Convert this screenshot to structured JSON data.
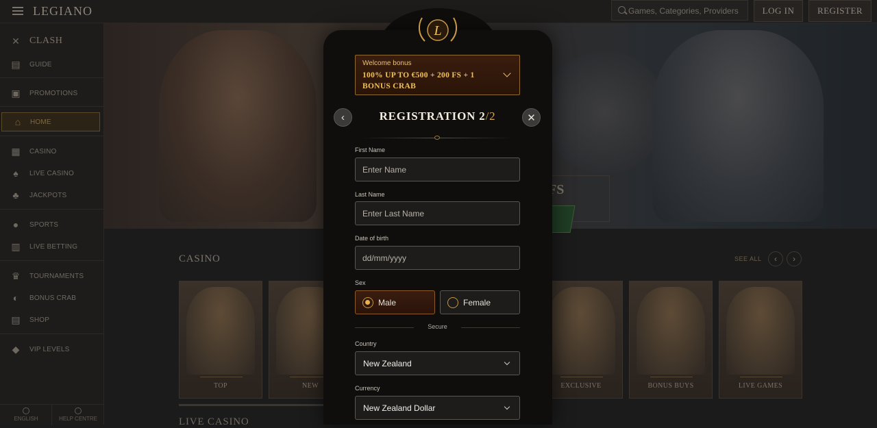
{
  "header": {
    "logo": "LEGIANO",
    "search_placeholder": "Games, Categories, Providers",
    "login_label": "LOG IN",
    "register_label": "REGISTER"
  },
  "sidebar": {
    "items": [
      {
        "label": "CLASH",
        "icon": "crossed-swords-icon"
      },
      {
        "label": "GUIDE",
        "icon": "scroll-icon"
      },
      {
        "label": "PROMOTIONS",
        "icon": "promotions-icon"
      },
      {
        "label": "HOME",
        "icon": "home-icon"
      },
      {
        "label": "CASINO",
        "icon": "slot-machine-icon"
      },
      {
        "label": "LIVE CASINO",
        "icon": "cards-icon"
      },
      {
        "label": "JACKPOTS",
        "icon": "clover-icon"
      },
      {
        "label": "SPORTS",
        "icon": "ball-icon"
      },
      {
        "label": "LIVE BETTING",
        "icon": "stadium-icon"
      },
      {
        "label": "TOURNAMENTS",
        "icon": "trophy-icon"
      },
      {
        "label": "BONUS CRAB",
        "icon": "crab-icon"
      },
      {
        "label": "SHOP",
        "icon": "shop-icon"
      },
      {
        "label": "VIP LEVELS",
        "icon": "diamond-icon"
      }
    ],
    "footer": {
      "language": "ENGLISH",
      "help": "HELP CENTRE"
    }
  },
  "hero": {
    "fs_text": "0 FS"
  },
  "casino_section": {
    "title": "CASINO",
    "see_all": "SEE ALL",
    "cards": [
      "TOP",
      "NEW",
      "",
      "",
      "EXCLUSIVE",
      "BONUS BUYS",
      "LIVE GAMES"
    ]
  },
  "next_section": {
    "title": "LIVE CASINO"
  },
  "modal": {
    "bonus": {
      "small": "Welcome bonus",
      "big": "100% UP TO €500 + 200 FS + 1 BONUS CRAB"
    },
    "title": "REGISTRATION",
    "step_current": "2",
    "step_total": "/2",
    "fields": {
      "first_name_label": "First Name",
      "first_name_placeholder": "Enter Name",
      "last_name_label": "Last Name",
      "last_name_placeholder": "Enter Last Name",
      "dob_label": "Date of birth",
      "dob_placeholder": "dd/mm/yyyy",
      "sex_label": "Sex",
      "sex_male": "Male",
      "sex_female": "Female",
      "secure_label": "Secure",
      "country_label": "Country",
      "country_value": "New Zealand",
      "currency_label": "Currency",
      "currency_value": "New Zealand Dollar"
    },
    "selected_sex": "Male"
  },
  "colors": {
    "accent_gold": "#f0c25c",
    "modal_bg": "#0f0e0d",
    "field_bg": "#1d1c1b"
  }
}
